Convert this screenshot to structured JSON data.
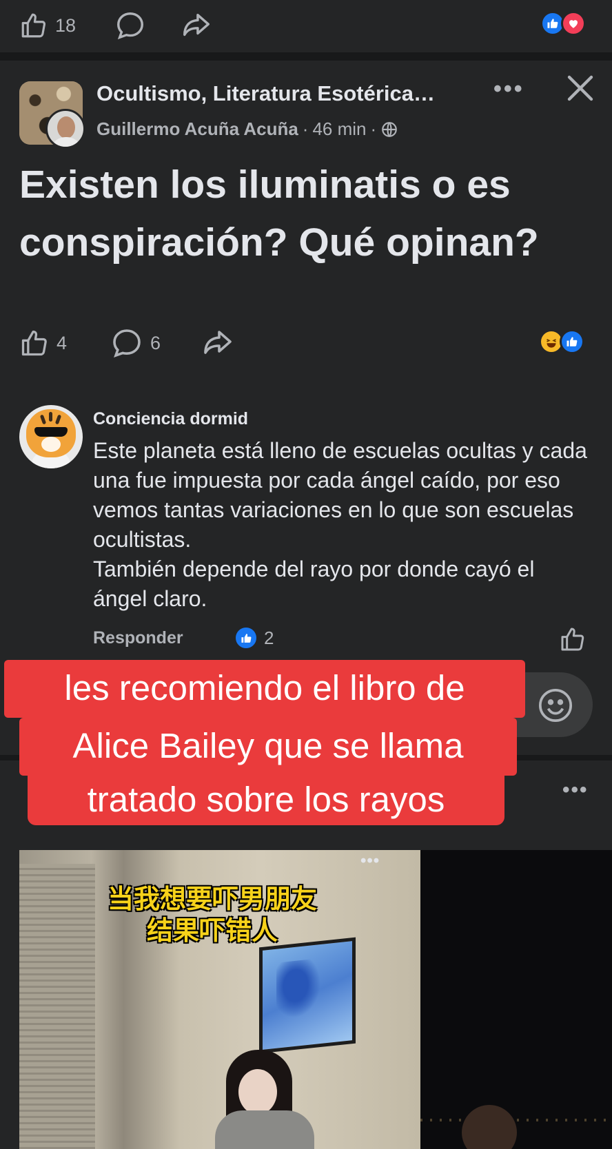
{
  "top_bar": {
    "like_count": "18",
    "reactions": [
      "like",
      "love"
    ]
  },
  "post": {
    "group_name": "Ocultismo, Literatura Esotérica…",
    "author": "Guillermo Acuña Acuña",
    "time": "46 min",
    "privacy_icon": "globe-icon",
    "title": "Existen los iluminatis o es conspiración? Qué opinan?",
    "like_count": "4",
    "comment_count": "6",
    "reactions": [
      "haha",
      "like"
    ]
  },
  "comment": {
    "author": "Conciencia dormid",
    "text": "Este planeta está lleno de escuelas ocultas y cada una fue impuesta por cada ángel caído, por eso vemos tantas variaciones en lo que son escuelas ocultistas.\nTambién depende del rayo por donde cayó el ángel claro.",
    "reply_label": "Responder",
    "like_count": "2"
  },
  "overlay_caption": {
    "line1": "les recomiendo el libro de",
    "line2": "Alice Bailey que se llama",
    "line3": "tratado sobre los rayos"
  },
  "video": {
    "caption": "当我想要吓男朋友\n结果吓错人"
  },
  "colors": {
    "background": "#18191a",
    "surface": "#242526",
    "text": "#e4e6eb",
    "muted": "#b0b3b8",
    "facebook_blue": "#1877f2",
    "love_red": "#f33e58",
    "overlay_red": "#ea3b3c",
    "caption_yellow": "#f7d21a"
  }
}
